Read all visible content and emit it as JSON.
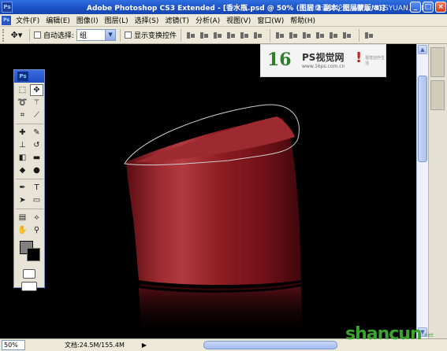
{
  "titlebar": {
    "title": "Adobe Photoshop CS3 Extended - [香水瓶.psd @ 50% (图层 2 副本, 图层蒙版/8)]",
    "watermark": "思缘设计论坛 www.MISSYUAN.COM",
    "app_badge": "Ps",
    "minimize": "_",
    "maximize": "□",
    "close": "×"
  },
  "menu": {
    "app_icon": "Ps",
    "items": [
      "文件(F)",
      "编辑(E)",
      "图像(I)",
      "图层(L)",
      "选择(S)",
      "滤镜(T)",
      "分析(A)",
      "视图(V)",
      "窗口(W)",
      "帮助(H)"
    ]
  },
  "options": {
    "tool_icon": "move-tool-icon",
    "tool_glyph": "✥▾",
    "auto_select_label": "自动选择:",
    "auto_select_value": "组",
    "show_transform_label": "显示变换控件"
  },
  "toolbox": {
    "header": "Ps",
    "tools": [
      {
        "name": "marquee-tool-icon",
        "glyph": "⬚"
      },
      {
        "name": "move-tool-icon",
        "glyph": "✥",
        "active": true
      },
      {
        "name": "lasso-tool-icon",
        "glyph": "➰"
      },
      {
        "name": "magic-wand-tool-icon",
        "glyph": "⚚"
      },
      {
        "name": "crop-tool-icon",
        "glyph": "⌗"
      },
      {
        "name": "slice-tool-icon",
        "glyph": "⟋"
      },
      {
        "name": "healing-brush-icon",
        "glyph": "✚"
      },
      {
        "name": "brush-tool-icon",
        "glyph": "✎"
      },
      {
        "name": "clone-stamp-icon",
        "glyph": "⊥"
      },
      {
        "name": "history-brush-icon",
        "glyph": "↺"
      },
      {
        "name": "eraser-tool-icon",
        "glyph": "◧"
      },
      {
        "name": "gradient-tool-icon",
        "glyph": "▬"
      },
      {
        "name": "blur-tool-icon",
        "glyph": "◆"
      },
      {
        "name": "dodge-tool-icon",
        "glyph": "●"
      },
      {
        "name": "pen-tool-icon",
        "glyph": "✒"
      },
      {
        "name": "type-tool-icon",
        "glyph": "T"
      },
      {
        "name": "path-selection-icon",
        "glyph": "➤"
      },
      {
        "name": "shape-tool-icon",
        "glyph": "▭"
      },
      {
        "name": "notes-tool-icon",
        "glyph": "▤"
      },
      {
        "name": "eyedropper-tool-icon",
        "glyph": "⟡"
      },
      {
        "name": "hand-tool-icon",
        "glyph": "✋"
      },
      {
        "name": "zoom-tool-icon",
        "glyph": "⚲"
      }
    ]
  },
  "logo": {
    "mark": "16",
    "name": "PS视觉网",
    "url": "www.16ps.com.cn",
    "bang": "!",
    "side_text": "视觉创作生活"
  },
  "status": {
    "zoom": "50%",
    "doc_info": "文档:24.5M/155.4M",
    "arrow": "▶"
  },
  "site_watermark": {
    "text": "shancun",
    "sub": ".net"
  },
  "colors": {
    "bottle_red": "#8c1c22",
    "canvas_bg": "#000000",
    "titlebar_blue": "#1b4fc4"
  }
}
